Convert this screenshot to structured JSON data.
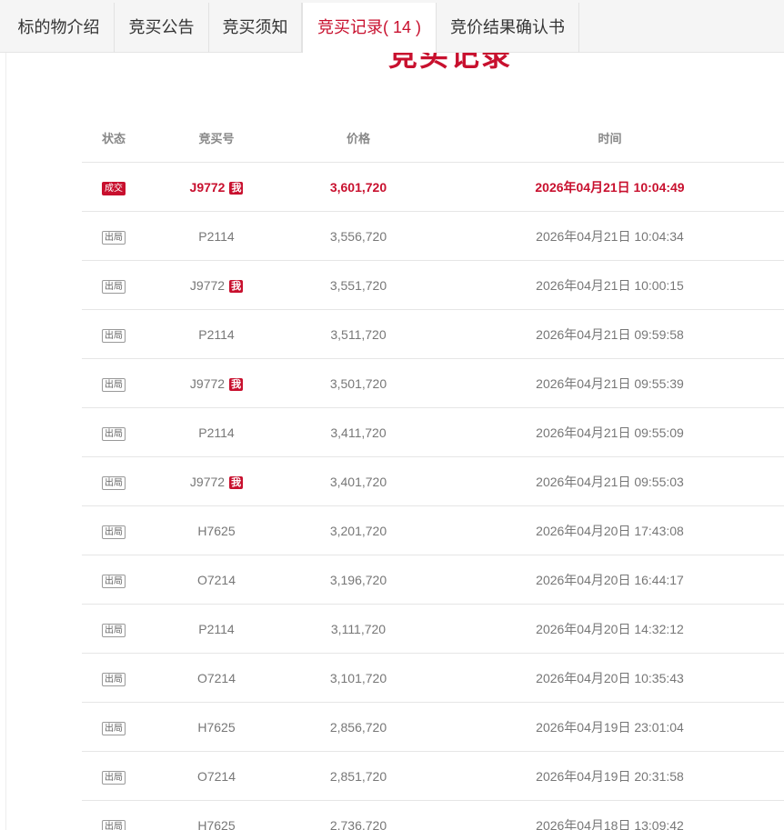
{
  "tabs": [
    {
      "label": "标的物介绍",
      "active": false
    },
    {
      "label": "竞买公告",
      "active": false
    },
    {
      "label": "竞买须知",
      "active": false
    },
    {
      "label": "竞买记录",
      "count": "( 14 )",
      "active": true
    },
    {
      "label": "竞价结果确认书",
      "active": false
    }
  ],
  "section_title": "竞买记录",
  "table": {
    "headers": {
      "status": "状态",
      "bid_id": "竞买号",
      "price": "价格",
      "time": "时间"
    },
    "me_label": "我",
    "rows": [
      {
        "status": "成交",
        "bid_id": "J9772",
        "me": true,
        "price": "3,601,720",
        "time": "2026年04月21日 10:04:49"
      },
      {
        "status": "出局",
        "bid_id": "P2114",
        "me": false,
        "price": "3,556,720",
        "time": "2026年04月21日 10:04:34"
      },
      {
        "status": "出局",
        "bid_id": "J9772",
        "me": true,
        "price": "3,551,720",
        "time": "2026年04月21日 10:00:15"
      },
      {
        "status": "出局",
        "bid_id": "P2114",
        "me": false,
        "price": "3,511,720",
        "time": "2026年04月21日 09:59:58"
      },
      {
        "status": "出局",
        "bid_id": "J9772",
        "me": true,
        "price": "3,501,720",
        "time": "2026年04月21日 09:55:39"
      },
      {
        "status": "出局",
        "bid_id": "P2114",
        "me": false,
        "price": "3,411,720",
        "time": "2026年04月21日 09:55:09"
      },
      {
        "status": "出局",
        "bid_id": "J9772",
        "me": true,
        "price": "3,401,720",
        "time": "2026年04月21日 09:55:03"
      },
      {
        "status": "出局",
        "bid_id": "H7625",
        "me": false,
        "price": "3,201,720",
        "time": "2026年04月20日 17:43:08"
      },
      {
        "status": "出局",
        "bid_id": "O7214",
        "me": false,
        "price": "3,196,720",
        "time": "2026年04月20日 16:44:17"
      },
      {
        "status": "出局",
        "bid_id": "P2114",
        "me": false,
        "price": "3,111,720",
        "time": "2026年04月20日 14:32:12"
      },
      {
        "status": "出局",
        "bid_id": "O7214",
        "me": false,
        "price": "3,101,720",
        "time": "2026年04月20日 10:35:43"
      },
      {
        "status": "出局",
        "bid_id": "H7625",
        "me": false,
        "price": "2,856,720",
        "time": "2026年04月19日 23:01:04"
      },
      {
        "status": "出局",
        "bid_id": "O7214",
        "me": false,
        "price": "2,851,720",
        "time": "2026年04月19日 20:31:58"
      },
      {
        "status": "出局",
        "bid_id": "H7625",
        "me": false,
        "price": "2,736,720",
        "time": "2026年04月18日 13:09:42"
      }
    ]
  },
  "colors": {
    "accent": "#c8102e",
    "text_muted": "#777777",
    "tab_bg": "#f5f5f5"
  }
}
